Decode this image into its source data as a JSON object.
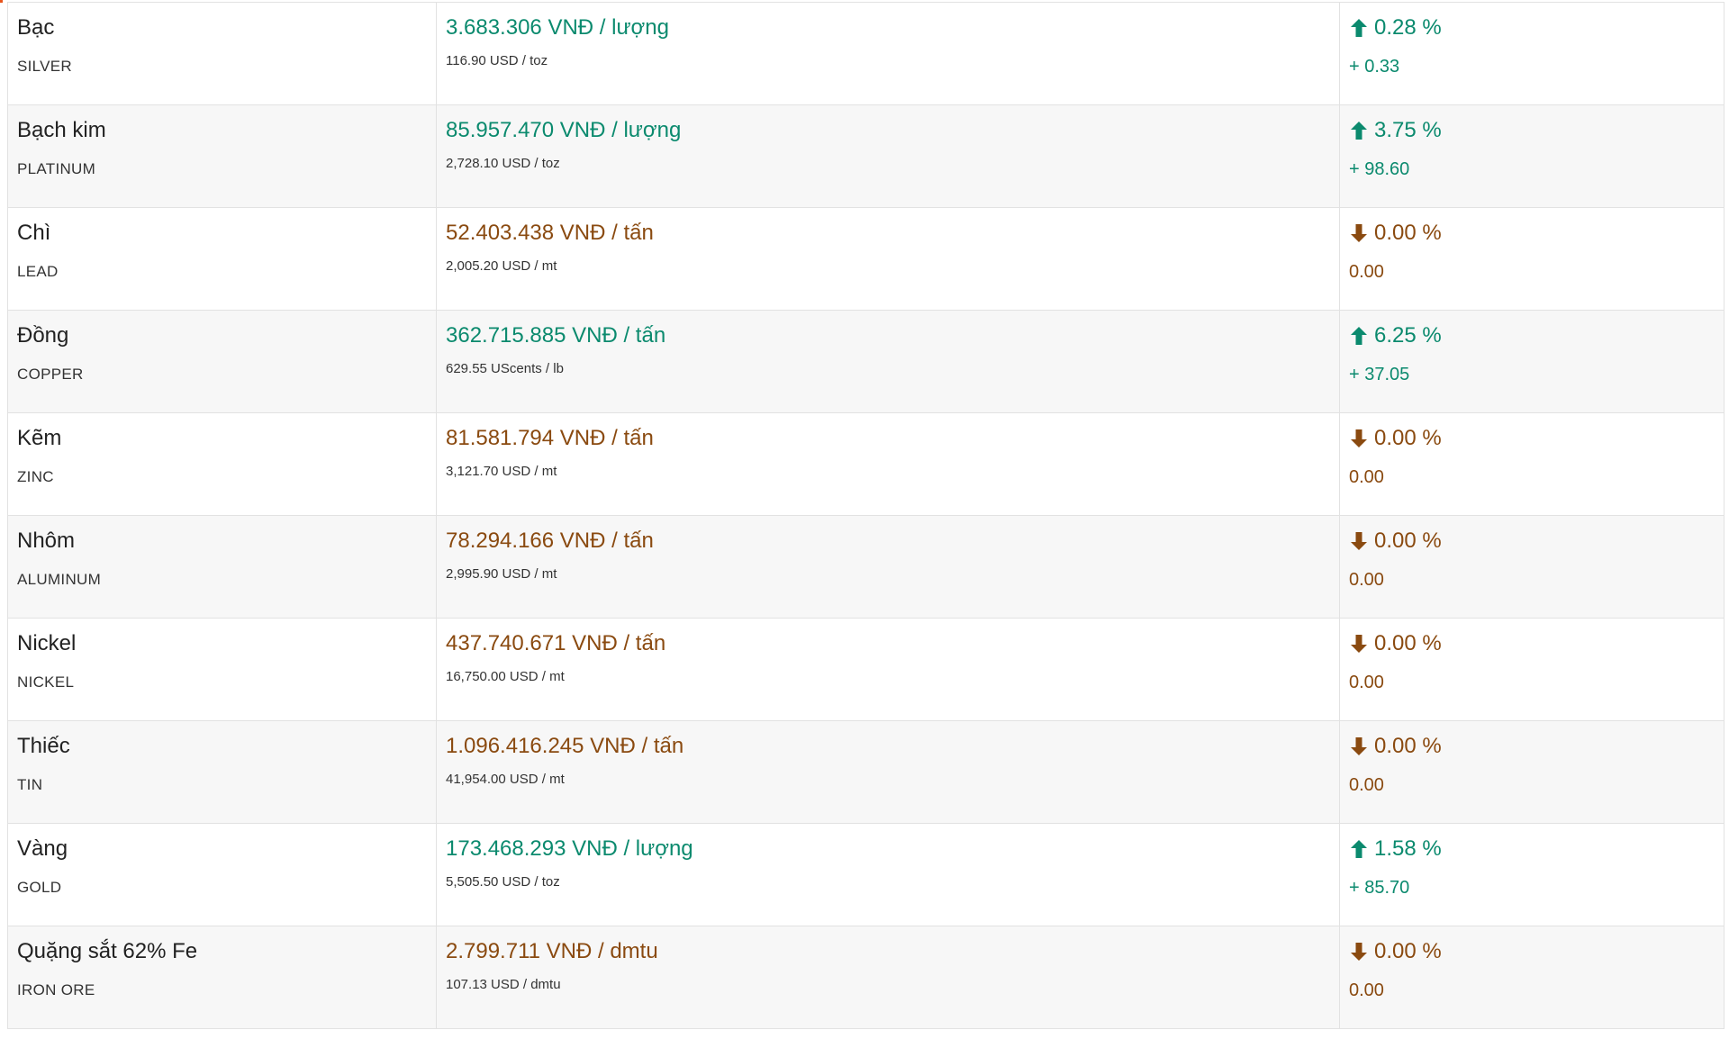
{
  "colors": {
    "up": "#0b8a6e",
    "down": "#8a4a10",
    "row_alt_bg": "#f7f7f7",
    "border": "#e2e2e2"
  },
  "icons": {
    "up": "arrow-up-icon",
    "down": "arrow-down-icon"
  },
  "rows": [
    {
      "name": "Bạc",
      "code": "SILVER",
      "price": "3.683.306 VNĐ / lượng",
      "price_usd": "116.90 USD / toz",
      "direction": "up",
      "pct": "0.28 %",
      "delta": "+ 0.33"
    },
    {
      "name": "Bạch kim",
      "code": "PLATINUM",
      "price": "85.957.470 VNĐ / lượng",
      "price_usd": "2,728.10 USD / toz",
      "direction": "up",
      "pct": "3.75 %",
      "delta": "+ 98.60"
    },
    {
      "name": "Chì",
      "code": "LEAD",
      "price": "52.403.438 VNĐ / tấn",
      "price_usd": "2,005.20 USD / mt",
      "direction": "down",
      "pct": "0.00 %",
      "delta": "0.00"
    },
    {
      "name": "Đồng",
      "code": "COPPER",
      "price": "362.715.885 VNĐ / tấn",
      "price_usd": "629.55 UScents / lb",
      "direction": "up",
      "pct": "6.25 %",
      "delta": "+ 37.05"
    },
    {
      "name": "Kẽm",
      "code": "ZINC",
      "price": "81.581.794 VNĐ / tấn",
      "price_usd": "3,121.70 USD / mt",
      "direction": "down",
      "pct": "0.00 %",
      "delta": "0.00"
    },
    {
      "name": "Nhôm",
      "code": "ALUMINUM",
      "price": "78.294.166 VNĐ / tấn",
      "price_usd": "2,995.90 USD / mt",
      "direction": "down",
      "pct": "0.00 %",
      "delta": "0.00"
    },
    {
      "name": "Nickel",
      "code": "NICKEL",
      "price": "437.740.671 VNĐ / tấn",
      "price_usd": "16,750.00 USD / mt",
      "direction": "down",
      "pct": "0.00 %",
      "delta": "0.00"
    },
    {
      "name": "Thiếc",
      "code": "TIN",
      "price": "1.096.416.245 VNĐ / tấn",
      "price_usd": "41,954.00 USD / mt",
      "direction": "down",
      "pct": "0.00 %",
      "delta": "0.00"
    },
    {
      "name": "Vàng",
      "code": "GOLD",
      "price": "173.468.293 VNĐ / lượng",
      "price_usd": "5,505.50 USD / toz",
      "direction": "up",
      "pct": "1.58 %",
      "delta": "+ 85.70"
    },
    {
      "name": "Quặng sắt 62% Fe",
      "code": "IRON ORE",
      "price": "2.799.711 VNĐ / dmtu",
      "price_usd": "107.13 USD / dmtu",
      "direction": "down",
      "pct": "0.00 %",
      "delta": "0.00"
    }
  ]
}
